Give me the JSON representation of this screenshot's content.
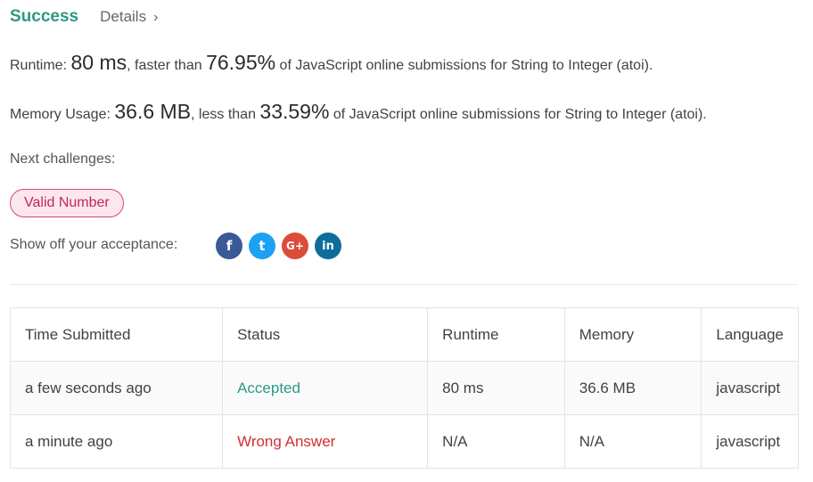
{
  "header": {
    "status": "Success",
    "details": "Details",
    "chevron": "›"
  },
  "runtime": {
    "label": "Runtime:",
    "value": "80 ms",
    "mid": ", faster than",
    "percent": "76.95%",
    "suffix": "of JavaScript online submissions for String to Integer (atoi)."
  },
  "memory": {
    "label": "Memory Usage:",
    "value": "36.6 MB",
    "mid": ", less than",
    "percent": "33.59%",
    "suffix": "of JavaScript online submissions for String to Integer (atoi)."
  },
  "next": {
    "label": "Next challenges:",
    "items": [
      "Valid Number"
    ]
  },
  "share": {
    "label": "Show off your acceptance:",
    "icons": [
      {
        "name": "facebook-icon",
        "glyph": "f",
        "color": "#3b5998"
      },
      {
        "name": "twitter-icon",
        "glyph": "t",
        "color": "#1da1f2"
      },
      {
        "name": "google-plus-icon",
        "glyph": "G+",
        "color": "#dd4b39"
      },
      {
        "name": "linkedin-icon",
        "glyph": "in",
        "color": "#0e6d9a"
      }
    ]
  },
  "table": {
    "headers": [
      "Time Submitted",
      "Status",
      "Runtime",
      "Memory",
      "Language"
    ],
    "rows": [
      [
        "a few seconds ago",
        "Accepted",
        "80 ms",
        "36.6 MB",
        "javascript"
      ],
      [
        "a minute ago",
        "Wrong Answer",
        "N/A",
        "N/A",
        "javascript"
      ]
    ]
  },
  "colors": {
    "success": "#2c9a82",
    "accepted": "#2c9a82",
    "wrong": "#d32f2f",
    "tag_border": "#d6457d",
    "tag_bg": "#fce7ef"
  }
}
